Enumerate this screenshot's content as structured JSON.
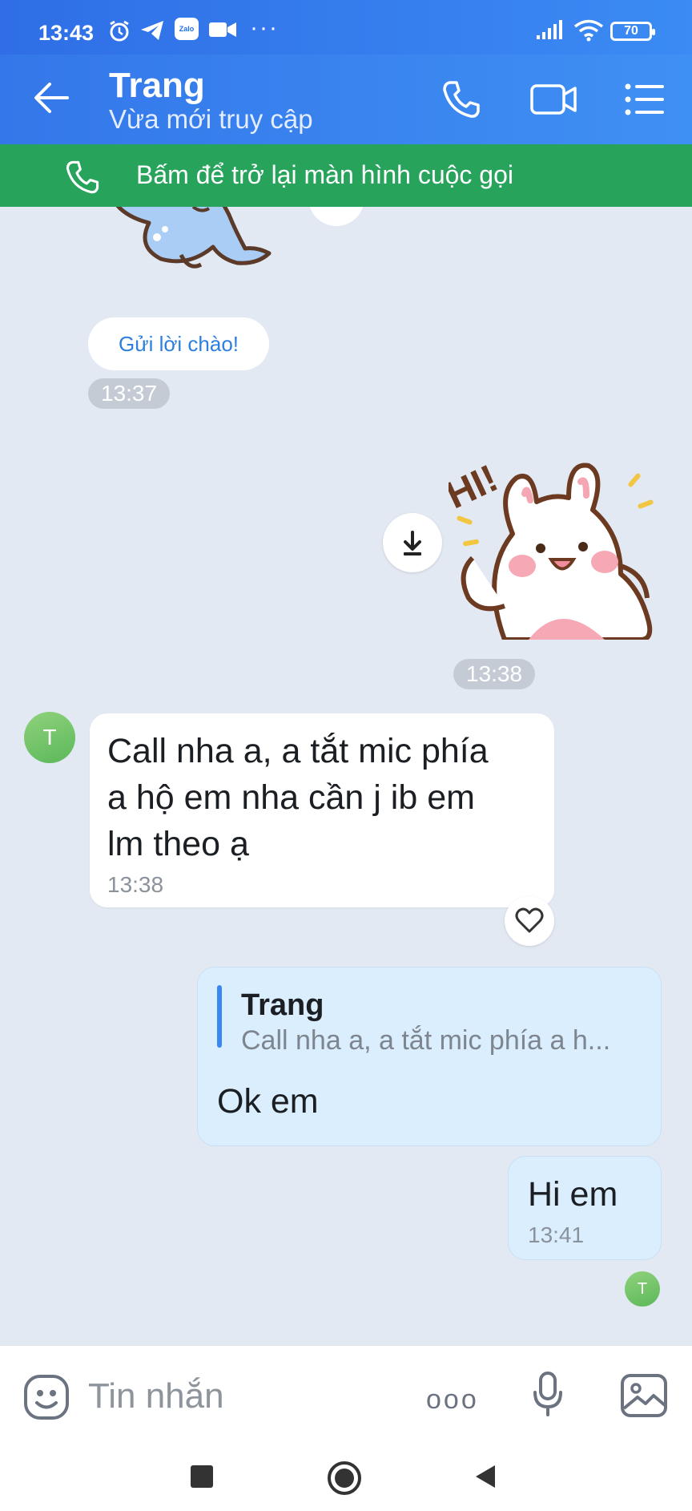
{
  "status_bar": {
    "time": "13:43",
    "app_badge": "Zalo",
    "more": "···",
    "battery": "70"
  },
  "header": {
    "title": "Trang",
    "subtitle": "Vừa mới truy cập",
    "icons": [
      "back-arrow-icon",
      "phone-icon",
      "video-call-icon",
      "menu-list-icon"
    ]
  },
  "call_banner": {
    "label": "Bấm để trở lại màn hình cuộc gọi",
    "icon": "phone-icon"
  },
  "messages": {
    "greeting_button": "Gửi lời chào!",
    "stamp_1": "13:37",
    "sticker_text": "HI!",
    "stamp_2": "13:38",
    "incoming": {
      "avatar": "T",
      "line1": "Call nha a, a tắt mic phía",
      "line2": "a hộ em nha cần j ib em",
      "line3": "lm theo ạ",
      "time": "13:38"
    },
    "reply": {
      "quote_author": "Trang",
      "quote_text": "Call nha a, a tắt mic phía a h...",
      "text": "Ok em"
    },
    "last": {
      "text": "Hi em",
      "time": "13:41",
      "seen_avatar": "T"
    }
  },
  "input": {
    "placeholder": "Tin nhắn",
    "more": "ooo"
  },
  "colors": {
    "header_blue": "#3b85f0",
    "banner_green": "#27a35c",
    "chat_bg": "#e2e9f3",
    "outgoing_bubble": "#dbeefe"
  }
}
